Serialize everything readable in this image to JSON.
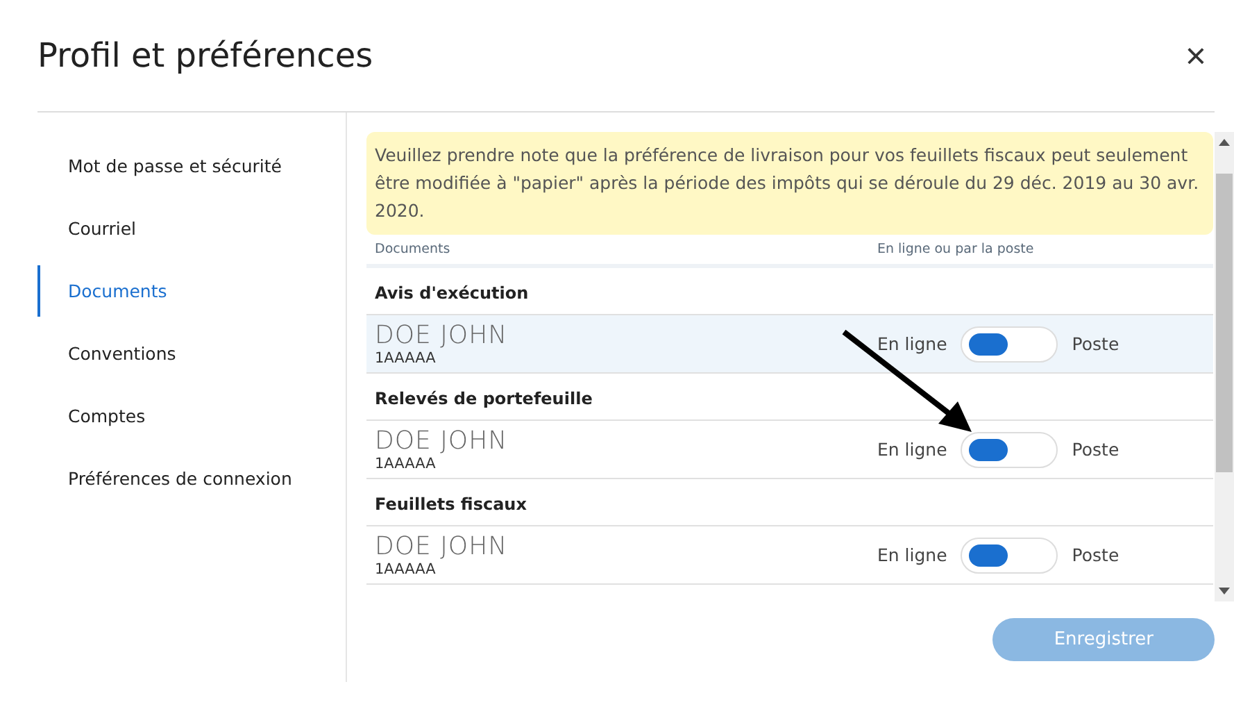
{
  "window": {
    "title": "Profil et préférences",
    "close": "×"
  },
  "sidebar": {
    "items": [
      {
        "label": "Mot de passe et sécurité",
        "selected": false
      },
      {
        "label": "Courriel",
        "selected": false
      },
      {
        "label": "Documents",
        "selected": true
      },
      {
        "label": "Conventions",
        "selected": false
      },
      {
        "label": "Comptes",
        "selected": false
      },
      {
        "label": "Préférences de connexion",
        "selected": false
      }
    ]
  },
  "notice": "Veuillez prendre note que la préférence de livraison pour vos feuillets fiscaux peut seulement être modifiée à \"papier\" après la période des impôts qui se déroule du 29 déc. 2019 au 30 avr. 2020.",
  "table": {
    "columns": [
      "Documents",
      "En ligne ou par la poste"
    ],
    "groups": [
      {
        "title": "Avis d'exécution",
        "rows": [
          {
            "name": "DOE JOHN",
            "account": "1AAAAA",
            "left": "En ligne",
            "right": "Poste",
            "online": true,
            "highlighted": true
          }
        ]
      },
      {
        "title": "Relevés de portefeuille",
        "rows": [
          {
            "name": "DOE JOHN",
            "account": "1AAAAA",
            "left": "En ligne",
            "right": "Poste",
            "online": true,
            "highlighted": false
          }
        ]
      },
      {
        "title": "Feuillets fiscaux",
        "rows": [
          {
            "name": "DOE JOHN",
            "account": "1AAAAA",
            "left": "En ligne",
            "right": "Poste",
            "online": true,
            "highlighted": false
          }
        ]
      }
    ]
  },
  "save_button": "Enregistrer"
}
